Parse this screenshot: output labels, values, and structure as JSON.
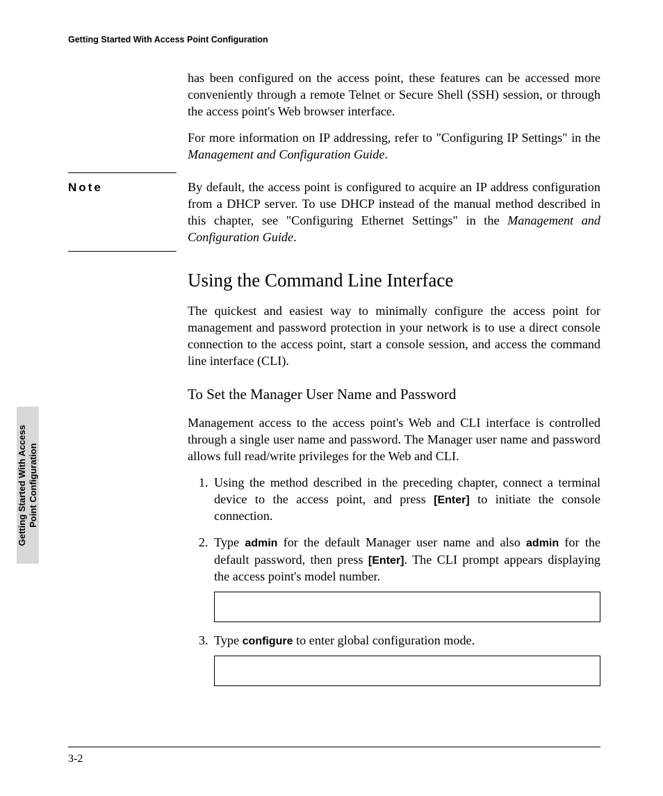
{
  "header": {
    "running_title": "Getting Started With Access Point Configuration"
  },
  "side_tab": {
    "line1": "Getting Started With Access",
    "line2": "Point Configuration"
  },
  "body": {
    "intro_p1": "has been configured on the access point, these features can be accessed more conveniently through a remote Telnet or Secure Shell (SSH) session, or through the access point's Web browser interface.",
    "intro_p2a": "For more information on IP addressing, refer to \"Configuring IP Settings\" in the ",
    "intro_p2b_italic": "Management and Configuration Guide",
    "intro_p2c": "."
  },
  "note": {
    "label": "Note",
    "text_a": "By default, the access point is configured to acquire an IP address configuration from a DHCP server. To use DHCP instead of the manual method described in this chapter, see \"Configuring Ethernet Settings\" in the ",
    "text_b_italic": "Management and Configuration Guide",
    "text_c": "."
  },
  "section": {
    "title": "Using the Command Line Interface",
    "p1": "The quickest and easiest way to minimally configure the access point for management and password protection in your network is to use a direct console connection to the access point, start a console session, and access the command line interface (CLI)."
  },
  "subsection": {
    "title": "To Set the Manager User Name and Password",
    "p1": "Management access to the access point's Web and CLI interface is controlled through a single user name and password. The Manager user name and password allows full read/write privileges for the Web and CLI."
  },
  "steps": {
    "s1_a": "Using the method described in the preceding chapter, connect a terminal device to the access point, and press ",
    "s1_key": "[Enter]",
    "s1_b": " to initiate the console connection.",
    "s2_a": "Type ",
    "s2_kw1": "admin",
    "s2_b": " for the default Manager user name and also ",
    "s2_kw2": "admin",
    "s2_c": " for the default password, then press ",
    "s2_key": "[Enter]",
    "s2_d": ". The CLI prompt appears displaying the access point's model number.",
    "s3_a": "Type ",
    "s3_kw": "configure",
    "s3_b": " to enter global configuration mode."
  },
  "footer": {
    "page_number": "3-2"
  }
}
